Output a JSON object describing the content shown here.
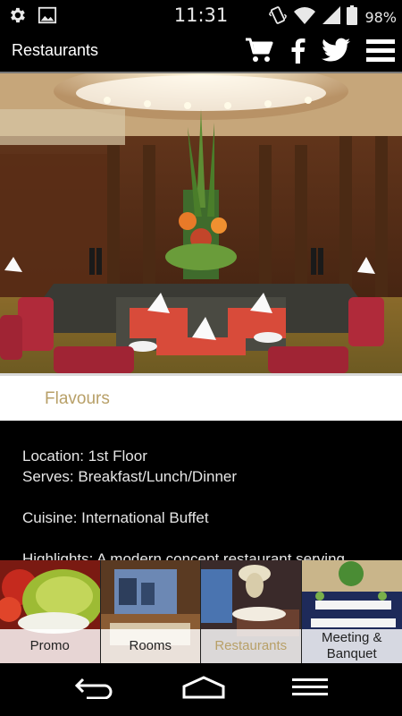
{
  "status_bar": {
    "time": "11:31",
    "battery": "98%",
    "icons": [
      "gear-icon",
      "image-icon",
      "vibrate-icon",
      "wifi-icon",
      "signal-icon",
      "battery-icon"
    ]
  },
  "header": {
    "title": "Restaurants",
    "actions": [
      "cart-icon",
      "facebook-icon",
      "twitter-icon",
      "menu-icon"
    ]
  },
  "section": {
    "title": "Flavours"
  },
  "details": {
    "location": "Location: 1st Floor",
    "serves": "Serves: Breakfast/Lunch/Dinner",
    "cuisine": "Cuisine: International Buffet",
    "highlights": "Highlights: A modern concept restaurant serving"
  },
  "tiles": [
    {
      "label": "Promo",
      "active": false
    },
    {
      "label": "Rooms",
      "active": false
    },
    {
      "label": "Restaurants",
      "active": true
    },
    {
      "label": "Meeting & Banquet",
      "active": false
    }
  ],
  "nav": [
    "back-icon",
    "home-icon",
    "recent-apps-icon"
  ],
  "colors": {
    "accent": "#b8a068",
    "background": "#000000",
    "band": "#ffffff"
  }
}
